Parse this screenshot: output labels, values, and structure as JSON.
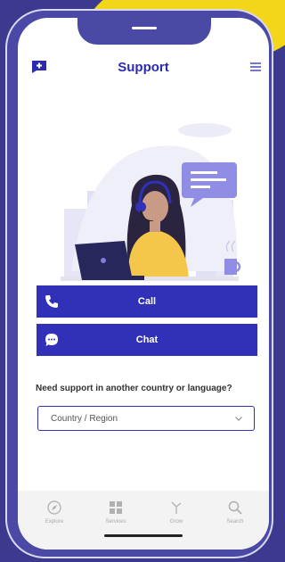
{
  "header": {
    "title": "Support"
  },
  "actions": {
    "call_label": "Call",
    "chat_label": "Chat"
  },
  "support": {
    "question": "Need support in another country or language?",
    "country_select": {
      "value": "Country / Region"
    }
  },
  "tabs": [
    {
      "label": "Explore",
      "icon": "compass-icon"
    },
    {
      "label": "Services",
      "icon": "grid-icon"
    },
    {
      "label": "Grow",
      "icon": "sprout-icon"
    },
    {
      "label": "Search",
      "icon": "search-icon"
    }
  ],
  "colors": {
    "accent": "#3030b8",
    "frame": "#4a4aa6",
    "background": "#3b3a8e",
    "highlight": "#f3d61a"
  }
}
